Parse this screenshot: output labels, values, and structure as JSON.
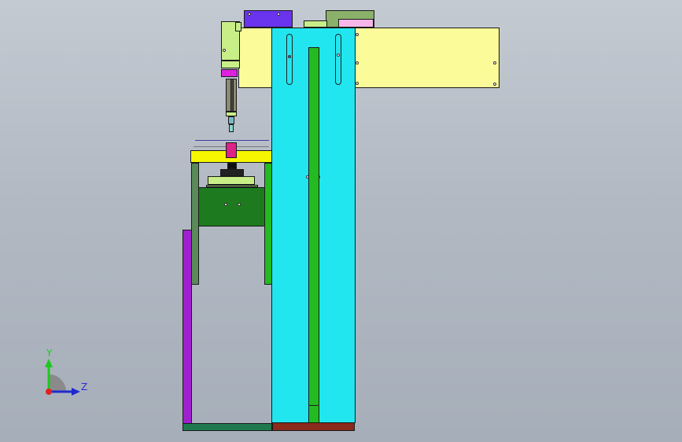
{
  "viewport": {
    "background_top": "#c4cad2",
    "background_bottom": "#a6aeb9"
  },
  "colors": {
    "cyan_column": "#22e6ef",
    "yellow_plate": "#fbfb9a",
    "green_bar": "#22bb22",
    "dark_green": "#1e7a1e",
    "purple_post": "#a020d0",
    "blue_block": "#6a33ee",
    "magenta": "#dd22dd",
    "light_green": "#c8ee88",
    "brown_base": "#8a2a1a",
    "yellow_beam": "#f6f600"
  },
  "triad": {
    "y_label": "Y",
    "z_label": "Z",
    "y_color": "#1ec81e",
    "z_color": "#1e2acf"
  }
}
